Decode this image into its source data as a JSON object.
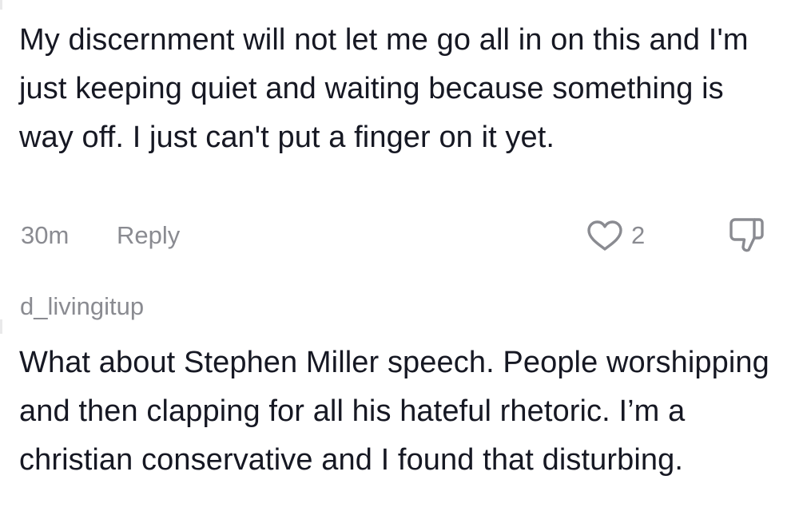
{
  "comments": [
    {
      "text": "My discernment will not let me go all in on this and I'm just keeping quiet and waiting because something is way off. I just can't put a finger on it yet.",
      "timestamp": "30m",
      "reply_label": "Reply",
      "like_count": "2",
      "icons": {
        "like": "heart-outline-icon",
        "dislike": "thumbs-down-outline-icon"
      }
    },
    {
      "username": "d_livingitup",
      "text": "What about Stephen Miller speech. People worshipping and then clapping for all his hateful rhetoric. I’m a christian conservative and I found that disturbing."
    }
  ],
  "colors": {
    "text": "#161823",
    "secondary_text": "#8a8b91",
    "background": "#ffffff"
  }
}
